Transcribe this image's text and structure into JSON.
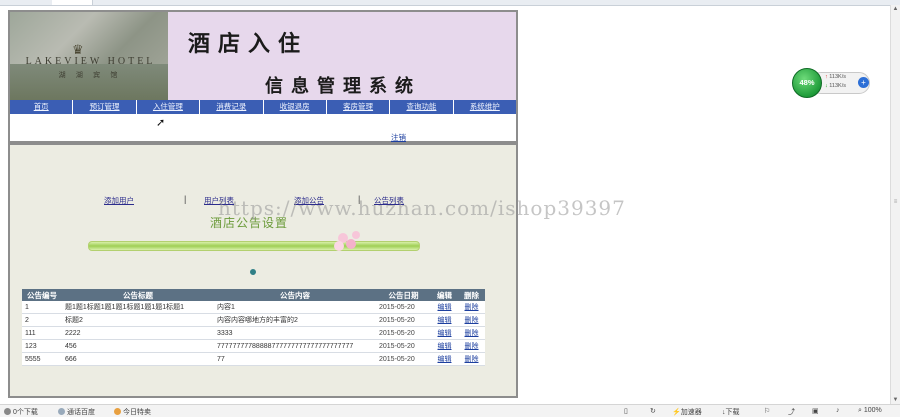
{
  "banner": {
    "logo_text": "LAKEVIEW HOTEL",
    "logo_sub": "湖 湖 宾 馆",
    "title_main": "酒店入住",
    "title_sub": "信息管理系统"
  },
  "nav": {
    "items": [
      "首页",
      "预订管理",
      "入住管理",
      "消费记录",
      "收银退房",
      "客房管理",
      "查询功能",
      "系统维护"
    ]
  },
  "logout_label": "注销",
  "sublinks": {
    "add_user": "添加用户",
    "user_list": "用户列表",
    "add_notice": "添加公告",
    "notice_list": "公告列表"
  },
  "section_title": "酒店公告设置",
  "table": {
    "headers": [
      "公告编号",
      "公告标题",
      "公告内容",
      "公告日期",
      "编辑",
      "删除"
    ],
    "rows": [
      {
        "id": "1",
        "title": "题1题1标题1题1题1标题1题1题1标题1",
        "content": "内容1",
        "date": "2015-05-20",
        "edit": "编辑",
        "del": "删除"
      },
      {
        "id": "2",
        "title": "标题2",
        "content": "内容内容哪地方的丰富的2",
        "date": "2015-05-20",
        "edit": "编辑",
        "del": "删除"
      },
      {
        "id": "111",
        "title": "2222",
        "content": "3333",
        "date": "2015-05-20",
        "edit": "编辑",
        "del": "删除"
      },
      {
        "id": "123",
        "title": "456",
        "content": "77777777788888777777777777777777777",
        "date": "2015-05-20",
        "edit": "编辑",
        "del": "删除"
      },
      {
        "id": "5555",
        "title": "666",
        "content": "77",
        "date": "2015-05-20",
        "edit": "编辑",
        "del": "删除"
      }
    ]
  },
  "watermark": "https://www.huzhan.com/ishop39397",
  "speed_widget": {
    "percent": "48%",
    "up": "113K/s",
    "down": "113K/s"
  },
  "statusbar": {
    "downloads": "0个下载",
    "speedup": "加速器",
    "download": "下载",
    "zoom": "100%",
    "left_items": [
      "0个下载",
      "通话百度",
      "今日特卖"
    ]
  },
  "colors": {
    "nav_bg": "#3b5eb4",
    "table_header": "#5c7184",
    "heading_green": "#6b9b3a",
    "banner_bg": "#e7d8ec"
  }
}
